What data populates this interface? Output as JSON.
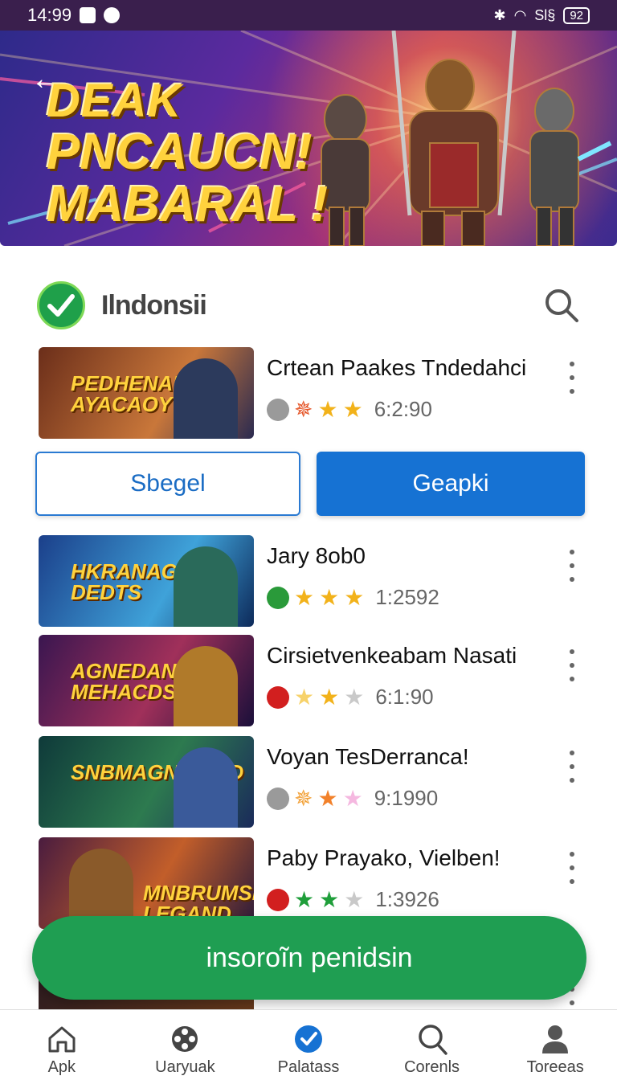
{
  "status_bar": {
    "time": "14:99",
    "signal_text": "Sl§",
    "battery": "92"
  },
  "hero": {
    "title_line1": "DEAK",
    "title_line2": "PNCAUCN!",
    "title_line3": "MABARAL !"
  },
  "section": {
    "brand": "Ilndonsii"
  },
  "games": [
    {
      "title": "Crtean Paakes Tndedahci",
      "thumb_text": "PEDHENAUN AYACAOY",
      "rating": "6:2:90",
      "colors": [
        "#8a3b1d",
        "#c9773a"
      ]
    },
    {
      "title": "Jary 8ob0",
      "thumb_text": "HKRANAGN DEDTS",
      "rating": "1:2592",
      "colors": [
        "#1b3f8a",
        "#3fa2d9"
      ]
    },
    {
      "title": "Cirsietvenkeabam Nasati",
      "thumb_text": "AGNEDAN MEHACDS",
      "rating": "6:1:90",
      "colors": [
        "#3a1650",
        "#a0305a"
      ]
    },
    {
      "title": "Voyan TesDerranca!",
      "thumb_text": "SNBMAGN DEND",
      "rating": "9:1990",
      "colors": [
        "#0f3a3a",
        "#2d7a4f"
      ]
    },
    {
      "title": "Paby Prayako, Vielben!",
      "thumb_text": "MNBRUMSH LEGAND",
      "rating": "1:3926",
      "colors": [
        "#4a1c3f",
        "#c25e2a"
      ]
    }
  ],
  "buttons": {
    "secondary": "Sbegel",
    "primary": "Geapki"
  },
  "cta": {
    "label": "insoroĩn penidsin"
  },
  "bottom_nav": [
    {
      "label": "Apk",
      "icon": "home-icon"
    },
    {
      "label": "Uaryuak",
      "icon": "film-reel-icon"
    },
    {
      "label": "Palatass",
      "icon": "check-badge-icon"
    },
    {
      "label": "Corenls",
      "icon": "search-icon"
    },
    {
      "label": "Toreeas",
      "icon": "person-icon"
    }
  ],
  "colors": {
    "accent_blue": "#1672d3",
    "cta_green": "#1f9e52",
    "hero_gold": "#ffd23d"
  }
}
